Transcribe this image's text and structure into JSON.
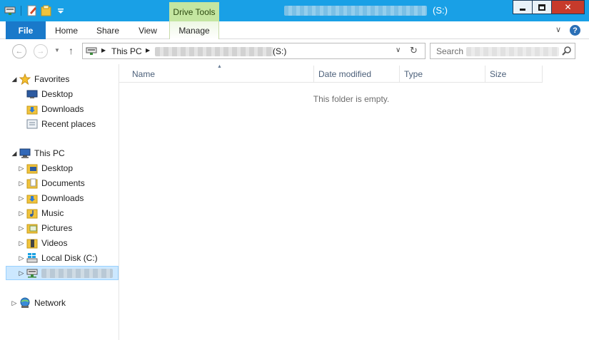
{
  "titlebar": {
    "context_tab": "Drive Tools",
    "title_suffix": "(S:)",
    "close_glyph": "✕"
  },
  "quick_access": {
    "icons": [
      "properties-icon",
      "new-folder-icon",
      "folder-icon",
      "customize-dropdown-icon"
    ]
  },
  "ribbon": {
    "tabs": [
      "File",
      "Home",
      "Share",
      "View",
      "Manage"
    ],
    "help_glyph": "?",
    "collapse_glyph": "∨"
  },
  "address_bar": {
    "breadcrumbs": [
      "This PC",
      "(S:)"
    ],
    "dropdown_glyph": "∨",
    "refresh_glyph": "↻"
  },
  "search": {
    "placeholder": "Search"
  },
  "nav": {
    "back_glyph": "←",
    "forward_glyph": "→",
    "recent_glyph": "▼",
    "up_glyph": "↑"
  },
  "tree": {
    "favorites": {
      "label": "Favorites",
      "items": [
        "Desktop",
        "Downloads",
        "Recent places"
      ]
    },
    "this_pc": {
      "label": "This PC",
      "items": [
        "Desktop",
        "Documents",
        "Downloads",
        "Music",
        "Pictures",
        "Videos",
        "Local Disk (C:)"
      ]
    },
    "network": {
      "label": "Network"
    },
    "expand_glyph": "▷",
    "collapse_glyph": "◢"
  },
  "file_list": {
    "columns": [
      "Name",
      "Date modified",
      "Type",
      "Size"
    ],
    "empty_message": "This folder is empty."
  },
  "colors": {
    "titlebar": "#19a0e6",
    "file_tab": "#1979ca",
    "drive_tools": "#c4e6a1",
    "close_button": "#c73a2b",
    "selection": "#cce8ff"
  }
}
